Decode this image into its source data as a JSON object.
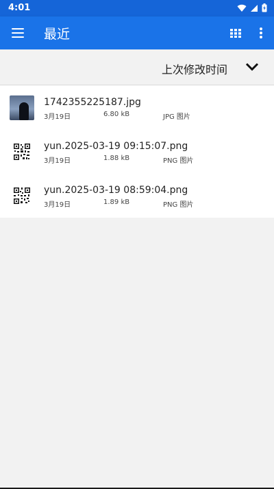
{
  "status": {
    "time": "4:01"
  },
  "appbar": {
    "title": "最近",
    "menu_icon": "menu-icon",
    "grid_icon": "grid-view-icon",
    "more_icon": "more-vert-icon"
  },
  "sort": {
    "label": "上次修改时间",
    "icon": "chevron-down-icon"
  },
  "files": [
    {
      "name": "1742355225187.jpg",
      "date": "3月19日",
      "size": "6.80 kB",
      "type": "JPG 图片",
      "thumb": "photo"
    },
    {
      "name": "yun.2025-03-19 09:15:07.png",
      "date": "3月19日",
      "size": "1.88 kB",
      "type": "PNG 图片",
      "thumb": "qr-code"
    },
    {
      "name": "yun.2025-03-19 08:59:04.png",
      "date": "3月19日",
      "size": "1.89 kB",
      "type": "PNG 图片",
      "thumb": "qr-code"
    }
  ],
  "colors": {
    "appbar": "#1a73e8",
    "statusbar": "#1565d8",
    "background": "#f2f2f2"
  }
}
